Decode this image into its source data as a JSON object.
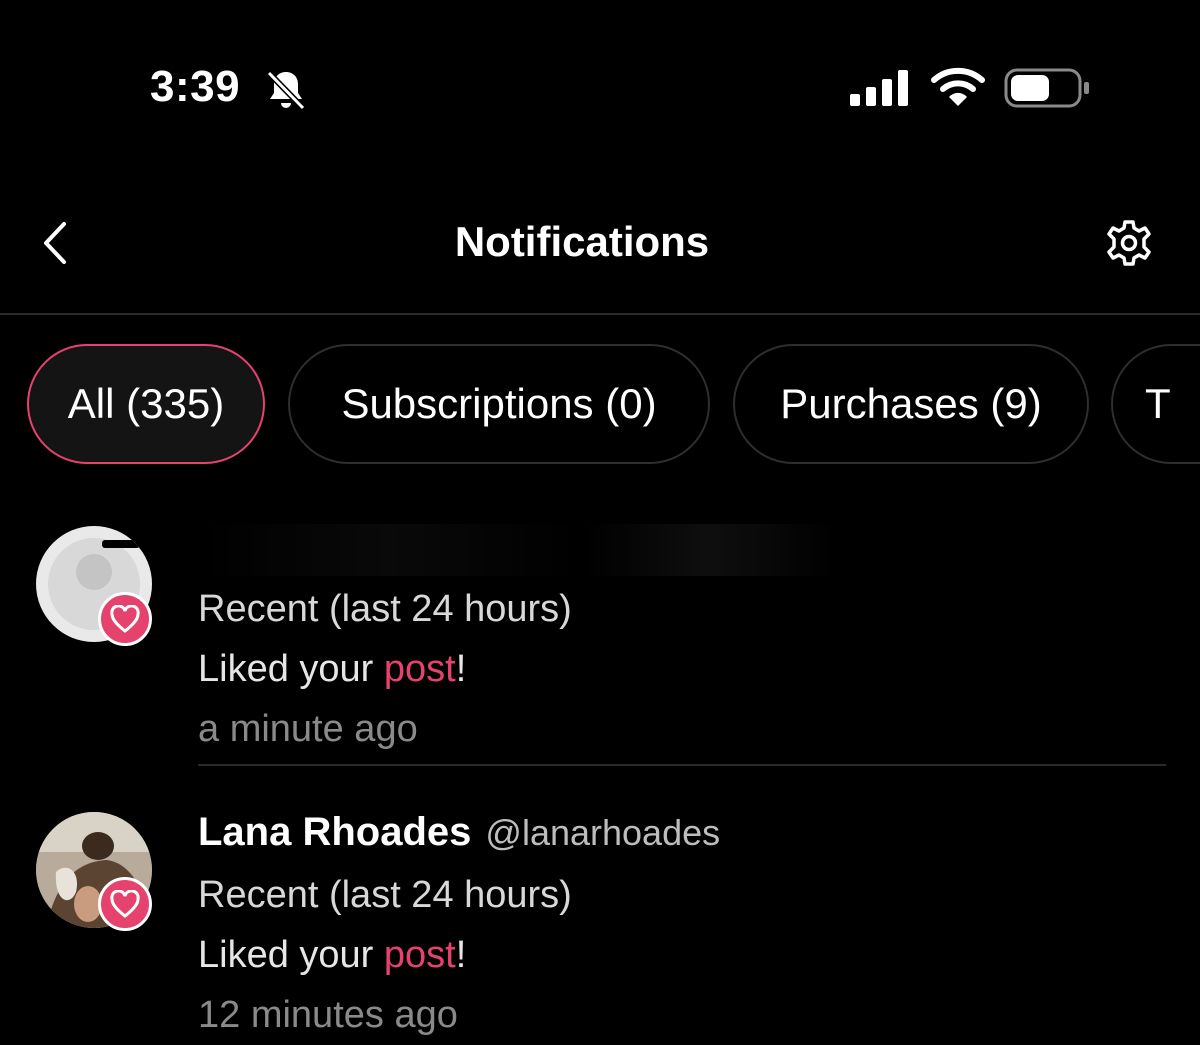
{
  "status_bar": {
    "time": "3:39",
    "icons": [
      "bell-slash-icon",
      "signal-icon",
      "wifi-icon",
      "battery-icon"
    ]
  },
  "header": {
    "title": "Notifications",
    "back_icon": "chevron-left-icon",
    "settings_icon": "gear-icon"
  },
  "tabs": [
    {
      "label": "All (335)",
      "active": true
    },
    {
      "label": "Subscriptions (0)",
      "active": false
    },
    {
      "label": "Purchases (9)",
      "active": false
    },
    {
      "label": "T",
      "active": false
    }
  ],
  "colors": {
    "accent": "#e5426e",
    "background": "#000000",
    "muted_text": "#8a8a8a",
    "divider": "#2a2a2a"
  },
  "notifications": [
    {
      "name": "",
      "handle": "",
      "period": "Recent (last 24 hours)",
      "action_prefix": "Liked your ",
      "action_link": "post",
      "action_suffix": "!",
      "time": "a minute ago",
      "badge_icon": "heart-icon"
    },
    {
      "name": "Lana Rhoades",
      "handle": "@lanarhoades",
      "period": "Recent (last 24 hours)",
      "action_prefix": "Liked your ",
      "action_link": "post",
      "action_suffix": "!",
      "time": "12 minutes ago",
      "badge_icon": "heart-icon"
    }
  ]
}
